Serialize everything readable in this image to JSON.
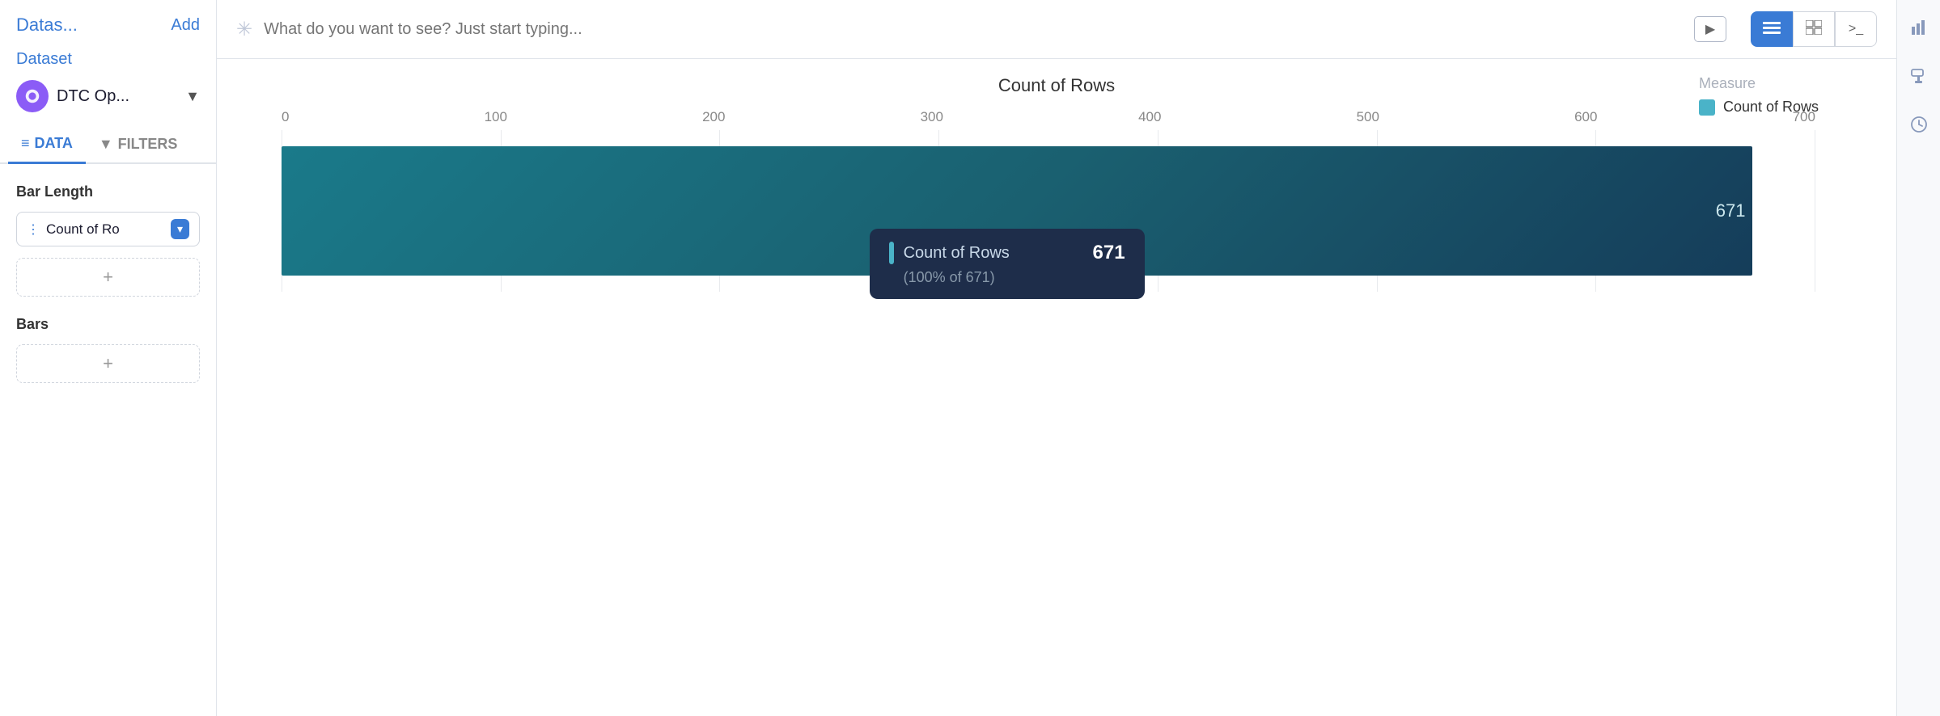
{
  "sidebar": {
    "add_label": "Add",
    "datasets_label": "Datas...",
    "dataset_label": "Dataset",
    "dataset_name": "DTC Op...",
    "tabs": [
      {
        "id": "data",
        "label": "DATA",
        "icon": "≡",
        "active": true
      },
      {
        "id": "filters",
        "label": "FILTERS",
        "icon": "▼",
        "active": false
      }
    ],
    "bar_length_label": "Bar Length",
    "bar_length_pill": "Count of Ro",
    "bars_label": "Bars",
    "add_measure_placeholder": "+",
    "add_bars_placeholder": "+"
  },
  "search": {
    "placeholder": "What do you want to see? Just start typing..."
  },
  "view_buttons": [
    {
      "id": "chart-view",
      "icon": "≡≡",
      "active": true
    },
    {
      "id": "table-view",
      "icon": "⊞",
      "active": false
    },
    {
      "id": "code-view",
      "icon": ">_",
      "active": false
    }
  ],
  "chart": {
    "title": "Count of Rows",
    "x_axis_labels": [
      "0",
      "100",
      "200",
      "300",
      "400",
      "500",
      "600",
      "700"
    ],
    "bar_value": "671",
    "bar_max": 671,
    "bar_display_max": 700,
    "legend": {
      "measure_title": "Measure",
      "items": [
        {
          "label": "Count of Rows",
          "color": "#4ab3c8"
        }
      ]
    },
    "tooltip": {
      "label": "Count of Rows",
      "value": "671",
      "percent": "(100% of 671)"
    }
  },
  "right_icons": [
    {
      "id": "chart-icon",
      "symbol": "📊"
    },
    {
      "id": "paint-icon",
      "symbol": "🎨"
    },
    {
      "id": "clock-icon",
      "symbol": "🕐"
    }
  ]
}
